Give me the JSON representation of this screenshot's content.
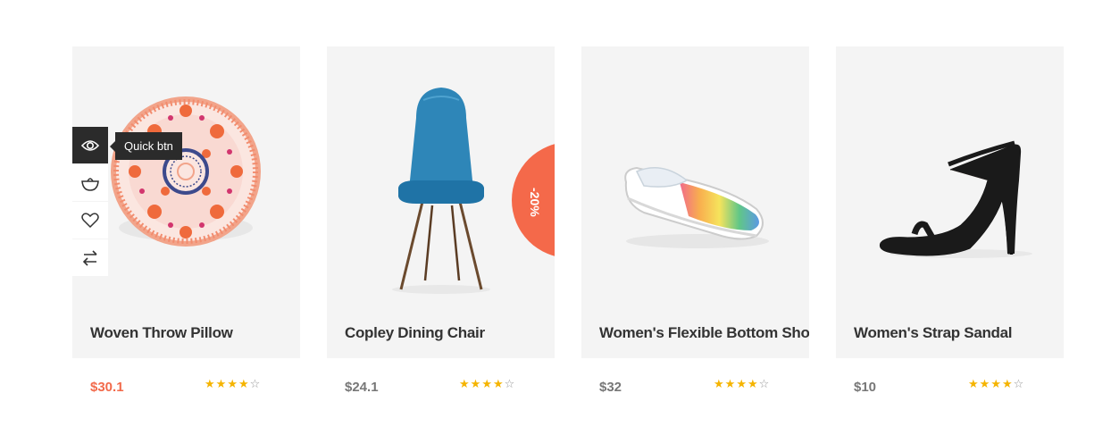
{
  "products": [
    {
      "title": "Woven Throw Pillow",
      "price": "$30.1",
      "rating": 4,
      "max_rating": 5
    },
    {
      "title": "Copley Dining Chair",
      "price": "$24.1",
      "rating": 4,
      "max_rating": 5,
      "badge": "-20%"
    },
    {
      "title": "Women's Flexible Bottom Shoes",
      "price": "$32",
      "rating": 4,
      "max_rating": 5
    },
    {
      "title": "Women's Strap Sandal",
      "price": "$10",
      "rating": 4,
      "max_rating": 5
    }
  ],
  "quick_actions": {
    "tooltip": "Quick btn",
    "icons": [
      "eye-icon",
      "basket-icon",
      "heart-icon",
      "compare-arrows-icon"
    ]
  },
  "colors": {
    "sale_price": "#f26a4b",
    "badge": "#f4694a",
    "star": "#f5b400",
    "card_background": "#f4f4f4"
  }
}
